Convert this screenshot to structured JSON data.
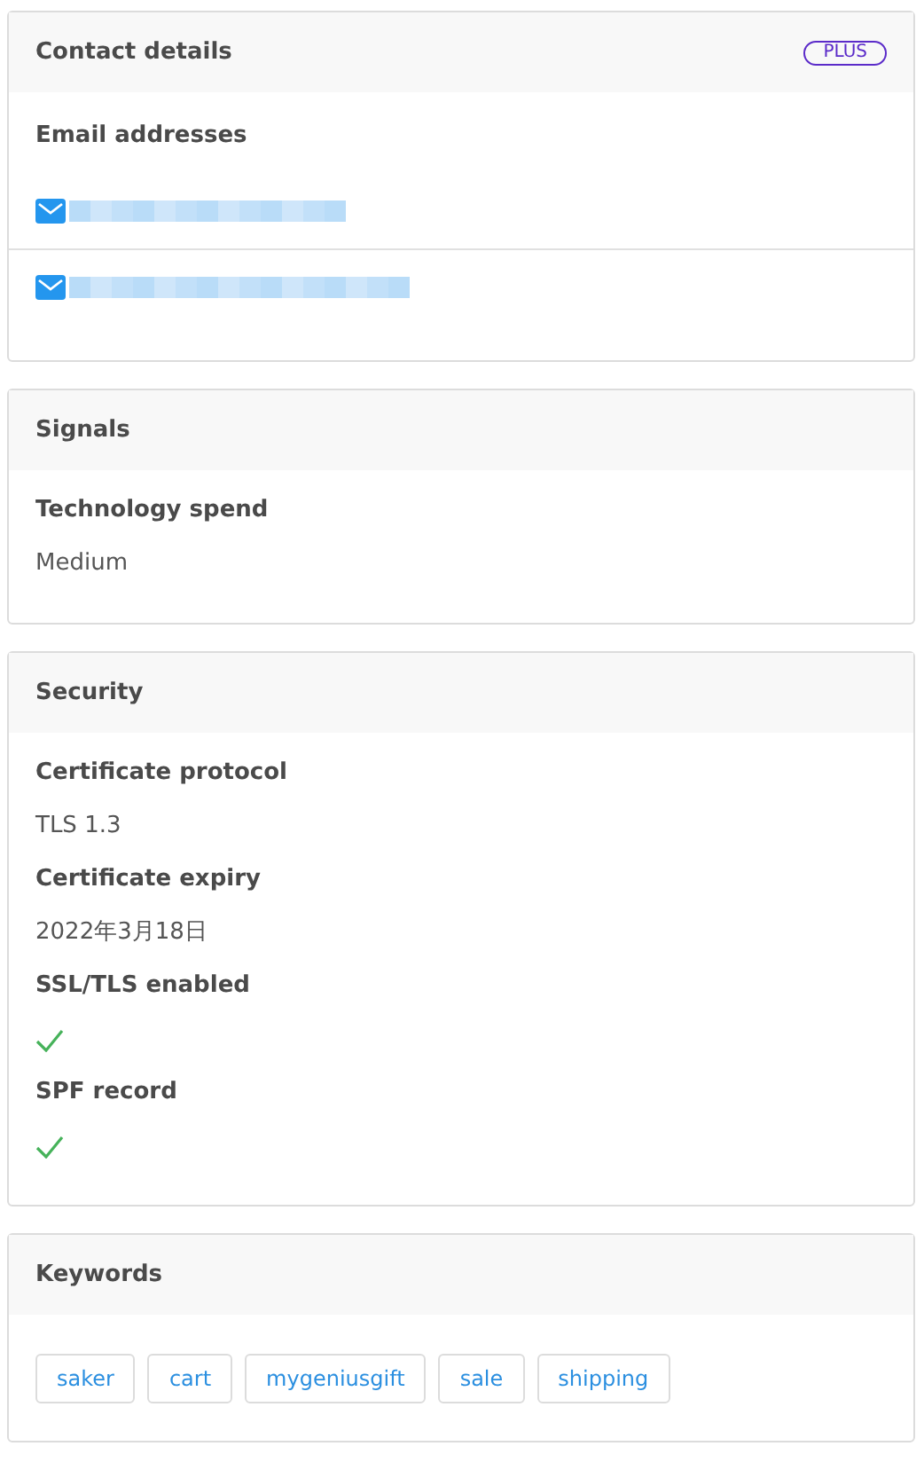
{
  "contact": {
    "title": "Contact details",
    "badge": "PLUS",
    "label": "Email addresses",
    "emails": [
      {
        "kind": "redacted"
      },
      {
        "kind": "redacted"
      }
    ]
  },
  "signals": {
    "title": "Signals",
    "fields": [
      {
        "kind": "text",
        "label": "Technology spend",
        "value": "Medium"
      }
    ]
  },
  "security": {
    "title": "Security",
    "fields": [
      {
        "kind": "text",
        "label": "Certificate protocol",
        "value": "TLS 1.3"
      },
      {
        "kind": "text",
        "label": "Certificate expiry",
        "value": "2022年3月18日"
      },
      {
        "kind": "check",
        "label": "SSL/TLS enabled",
        "checked": true
      },
      {
        "kind": "check",
        "label": "SPF record",
        "checked": true
      }
    ]
  },
  "keywords": {
    "title": "Keywords",
    "tags": [
      "saker",
      "cart",
      "mygeniusgift",
      "sale",
      "shipping"
    ]
  }
}
